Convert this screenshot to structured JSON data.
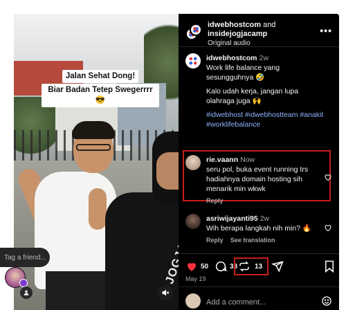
{
  "video": {
    "caption_line1": "Jalan Sehat Dong!",
    "caption_line2": "Biar Badan Tetep Swegerrrr 😎",
    "shirt_text": "JOGJACAMP"
  },
  "header": {
    "user1": "idwebhostcom",
    "joiner": " and",
    "user2": "insidejogjacamp",
    "audio": "Original audio",
    "more": "•••"
  },
  "post": {
    "user": "idwebhostcom",
    "time": "2w",
    "text1": "Work life balance yang sesungguhnya 🤣",
    "text2": "Kalo udah kerja, jangan lupa olahraga juga 🙌",
    "hashtags": "#idwebhost #idwebhostteam #anakit #worklifebalance"
  },
  "comments": [
    {
      "user": "rie.vaann",
      "time": "Now",
      "text": "seru pol, buka event running trs hadiahnya domain hosting sih menarik min wkwk",
      "reply": "Reply"
    },
    {
      "user": "asriwijayanti95",
      "time": "2w",
      "text": "Wih berapa langkah nih min? 🔥",
      "reply": "Reply",
      "translate": "See translation"
    }
  ],
  "actions": {
    "likes": "50",
    "comments": "33",
    "reposts": "13",
    "date": "May 19"
  },
  "add_comment": {
    "placeholder": "Add a comment..."
  },
  "tag_friend": {
    "placeholder": "Tag a friend..."
  },
  "colors": {
    "like_red": "#ff3040",
    "highlight": "#c91c1c",
    "link": "#8fb4ff"
  }
}
